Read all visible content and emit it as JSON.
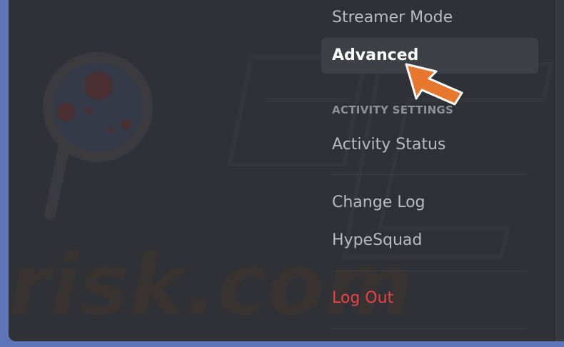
{
  "menu": {
    "streamer_mode": "Streamer Mode",
    "advanced": "Advanced",
    "activity_section_header": "ACTIVITY SETTINGS",
    "activity_status": "Activity Status",
    "change_log": "Change Log",
    "hypesquad": "HypeSquad",
    "log_out": "Log Out"
  },
  "watermark": {
    "text": "risk.com"
  },
  "colors": {
    "background": "#2f3136",
    "selected": "#3d4046",
    "danger": "#ed4245",
    "arrow": "#e8772e"
  },
  "icons": {
    "arrow": "pointer-arrow-icon"
  }
}
